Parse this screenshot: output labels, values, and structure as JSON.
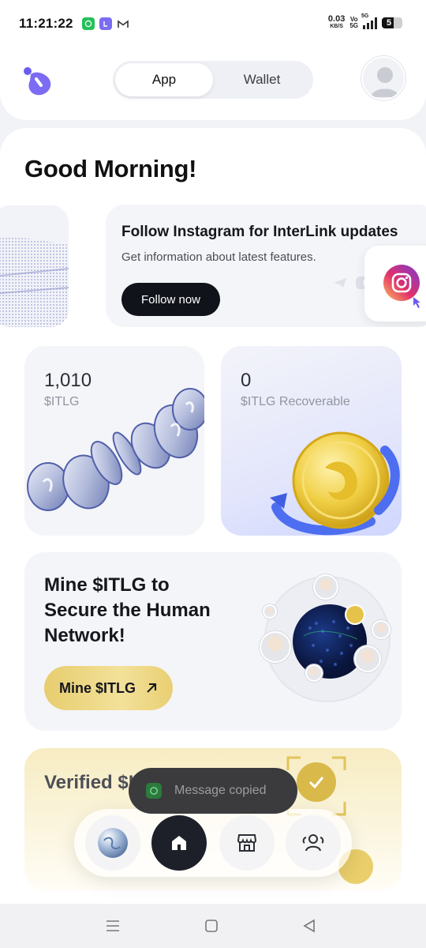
{
  "status_bar": {
    "time": "11:21:22",
    "net_speed": "0.03",
    "net_unit": "KB/S",
    "volte": "Vo",
    "volte2": "5G",
    "network": "5G",
    "battery": "5",
    "notification_icons": [
      "whatsapp-icon",
      "app-icon",
      "gmail-icon"
    ]
  },
  "header": {
    "tabs": [
      {
        "label": "App",
        "active": true
      },
      {
        "label": "Wallet",
        "active": false
      }
    ]
  },
  "greeting": "Good Morning!",
  "promo": {
    "title": "Follow Instagram for InterLink updates",
    "subtitle": "Get information about latest features.",
    "button": "Follow now"
  },
  "balances": [
    {
      "value": "1,010",
      "unit": "$ITLG"
    },
    {
      "value": "0",
      "unit": "$ITLG Recoverable"
    }
  ],
  "mine": {
    "title": "Mine $ITLG to Secure the Human Network!",
    "button": "Mine $ITLG"
  },
  "verified": {
    "title": "Verified $I"
  },
  "toast": {
    "text": "Message copied"
  },
  "dock": {
    "items": [
      "globe-icon",
      "home-icon",
      "store-icon",
      "people-icon"
    ]
  },
  "colors": {
    "accent": "#6b5cf0",
    "dark": "#10131a",
    "gold": "#e7cd6f"
  }
}
